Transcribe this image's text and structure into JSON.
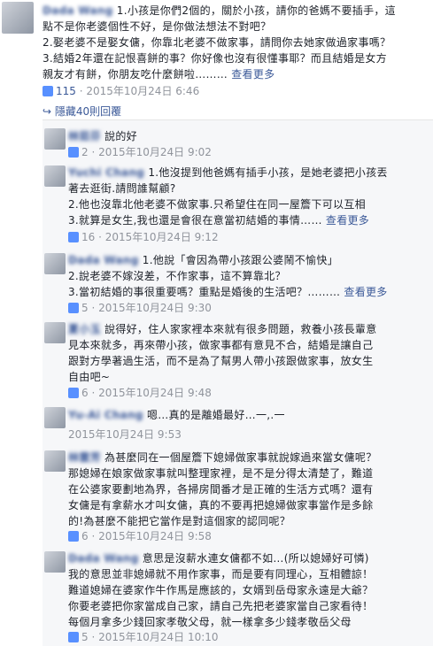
{
  "post": {
    "author": "Dada Wang",
    "lines": [
      "1.小孩是你們2個的，關於小孩，請你的爸媽不要插手，這",
      "點不是你老婆個性不好，是你做法想法不對吧？",
      "2.娶老婆不是娶女傭，你靠北老婆不做家事，請問你去她家做過家事嗎？",
      "3.結婚2年還在記恨喜餅的事？你好像也沒有很懂事耶？而且結婚是女方",
      "親友才有餅，你朋友吃什麼餅啦………"
    ],
    "see_more": "查看更多",
    "likes": "115",
    "timestamp": "2015年10月24日 6:46"
  },
  "hidden_replies_label": "隱藏40則回覆",
  "replies": [
    {
      "author": "林茹芬",
      "lines": [
        "說的好"
      ],
      "likes": "2",
      "timestamp": "2015年10月24日 9:02"
    },
    {
      "author": "Yuchi Chang",
      "lines": [
        "1.他沒提到他爸媽有插手小孩，是她老婆把小孩丟",
        "著去逛街.請問誰幫顧?",
        "2.他也沒靠北他老婆不做家事.只希望住在同一屋簷下可以互相",
        "3.就算是女生,我也還是會很在意當初結婚的事情……"
      ],
      "see_more": "查看更多",
      "likes": "16",
      "timestamp": "2015年10月24日 9:12"
    },
    {
      "author": "Dada Wang",
      "lines": [
        "1.他說「會因為帶小孩跟公婆鬧不愉快」",
        "2.說老婆不嫁沒差，不作家事，這不算靠北？",
        "3.當初結婚的事很重要嗎？重點是婚後的生活吧？………"
      ],
      "see_more": "查看更多",
      "likes": "5",
      "timestamp": "2015年10月24日 9:30"
    },
    {
      "author": "夏小玉",
      "lines": [
        "說得好，住人家家裡本來就有很多問題，救養小孩長輩意",
        "見本來就多，再來帶小孩，做家事都有意見不合，結婚是讓自己",
        "跟對方學著過生活，而不是為了幫男人帶小孩跟做家事，放女生",
        "自由吧~"
      ],
      "likes": "6",
      "timestamp": "2015年10月24日 9:48"
    },
    {
      "author": "Yu-Ai Chang",
      "lines": [
        "嗯…真的是離婚最好…一,.一"
      ],
      "likes": "",
      "timestamp": "2015年10月24日 9:53"
    },
    {
      "author": "林雲芳",
      "lines": [
        "為甚麼同在一個屋簷下媳婦做家事就說嫁過來當女傭呢？",
        "那媳婦在娘家做家事就叫整理家裡，是不是分得太清楚了，難道",
        "在公婆家要劃地為界，各掃房間番才是正確的生活方式嗎？還有",
        "女傭是有拿薪水才叫女傭，真的不要再把媳婦做家事當作是多餘",
        "的!為甚麼不能把它當作是對這個家的認同呢？"
      ],
      "likes": "6",
      "timestamp": "2015年10月24日 9:58"
    },
    {
      "author": "Dada Wang",
      "lines": [
        "意思是沒薪水連女傭都不如…(所以媳婦好可憐)",
        "我的意思並非媳婦就不用作家事，而是要有同理心，互相體諒！",
        "難道媳婦在婆家作牛作馬是應該的，女婿到岳母家永遠是大爺？",
        "你要老婆把你家當成自己家，請自己先把老婆家當自己家看待！",
        "每個月拿多少錢回家孝敬父母，就一樣拿多少錢孝敬岳父母"
      ],
      "likes": "5",
      "timestamp": "2015年10月24日 10:10"
    }
  ]
}
